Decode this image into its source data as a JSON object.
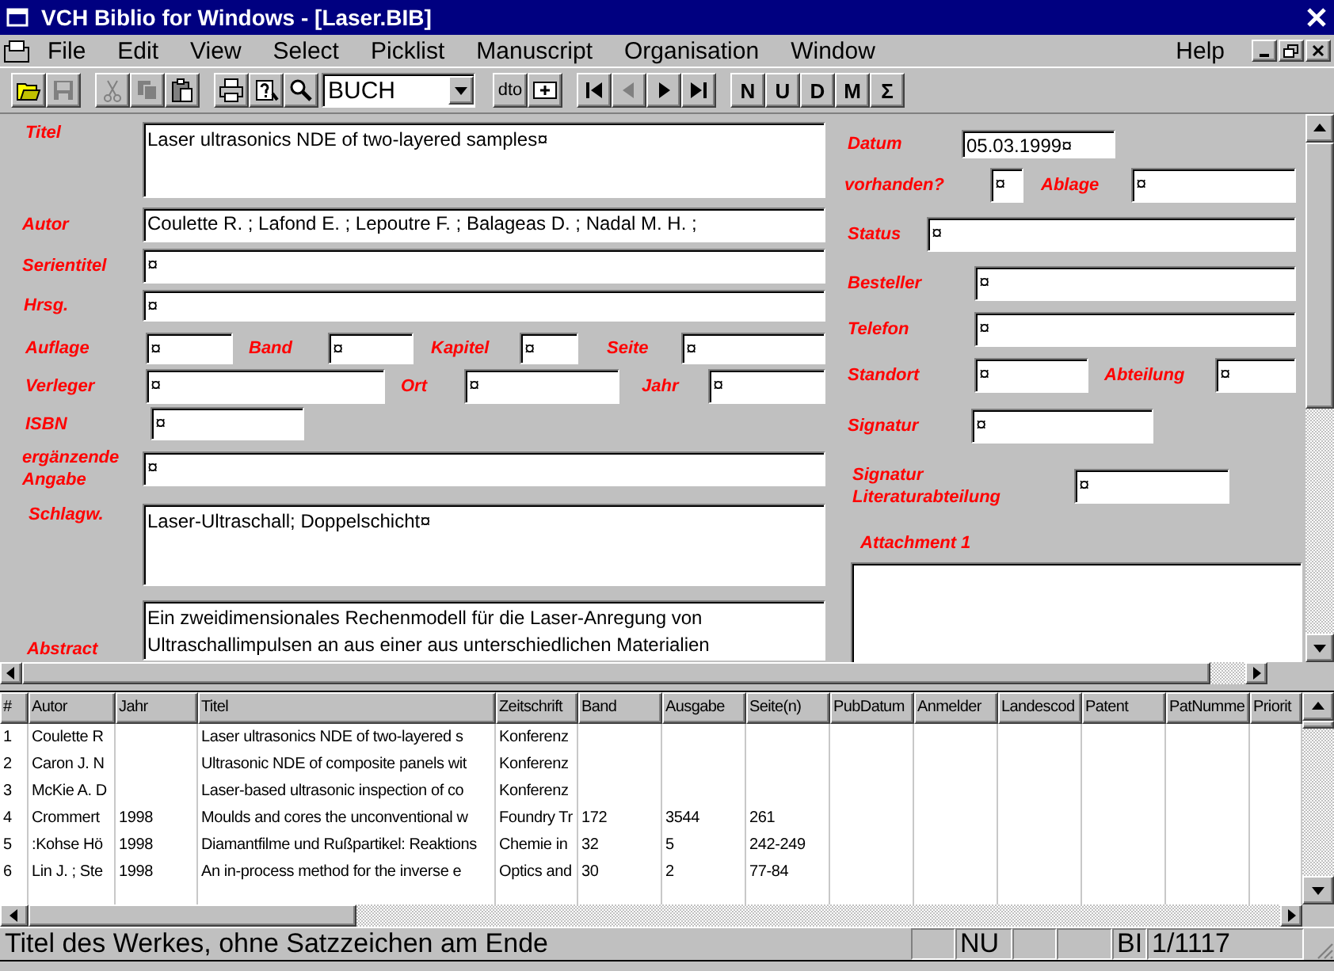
{
  "window": {
    "title": "VCH Biblio for Windows - [Laser.BIB]"
  },
  "menu": {
    "items": [
      "File",
      "Edit",
      "View",
      "Select",
      "Picklist",
      "Manuscript",
      "Organisation",
      "Window"
    ],
    "help": "Help"
  },
  "toolbar": {
    "groups": [
      {
        "items": [
          {
            "kind": "open",
            "disabled": false
          },
          {
            "kind": "save",
            "disabled": true
          }
        ]
      },
      {
        "items": [
          {
            "kind": "cut",
            "disabled": true
          },
          {
            "kind": "copy",
            "disabled": true
          },
          {
            "kind": "paste",
            "disabled": false
          }
        ]
      },
      {
        "items": [
          {
            "kind": "print",
            "disabled": false
          },
          {
            "kind": "help",
            "disabled": false
          },
          {
            "kind": "search",
            "disabled": false
          },
          {
            "kind": "combo",
            "value": "BUCH"
          }
        ]
      },
      {
        "items": [
          {
            "kind": "text",
            "label": "dto",
            "disabled": false
          },
          {
            "kind": "add",
            "disabled": false
          }
        ]
      },
      {
        "items": [
          {
            "kind": "first",
            "disabled": false
          },
          {
            "kind": "prev",
            "disabled": true
          },
          {
            "kind": "next",
            "disabled": false
          },
          {
            "kind": "last",
            "disabled": false
          }
        ]
      },
      {
        "items": [
          {
            "kind": "text",
            "label": "N",
            "disabled": false
          },
          {
            "kind": "text",
            "label": "U",
            "disabled": false
          },
          {
            "kind": "text",
            "label": "D",
            "disabled": false
          },
          {
            "kind": "text",
            "label": "M",
            "disabled": false
          },
          {
            "kind": "text",
            "label": "Σ",
            "disabled": false
          }
        ]
      }
    ]
  },
  "form": {
    "left": [
      [
        {
          "kind": "label",
          "text": "Titel"
        },
        {
          "kind": "memo",
          "value": "Laser ultrasonics NDE of two-layered samples¤"
        }
      ],
      [
        {
          "kind": "label",
          "text": "Autor"
        },
        {
          "kind": "field",
          "value": "Coulette R. ; Lafond E. ; Lepoutre F. ; Balageas D. ; Nadal M. H. ;"
        }
      ],
      [
        {
          "kind": "label",
          "text": "Serientitel"
        },
        {
          "kind": "field",
          "value": "¤"
        }
      ],
      [
        {
          "kind": "label",
          "text": "Hrsg."
        },
        {
          "kind": "field",
          "value": "¤"
        }
      ],
      [
        {
          "kind": "label",
          "text": "Auflage"
        },
        {
          "kind": "field",
          "value": "¤"
        },
        {
          "kind": "label",
          "text": "Band"
        },
        {
          "kind": "field",
          "value": "¤"
        },
        {
          "kind": "label",
          "text": "Kapitel"
        },
        {
          "kind": "field",
          "value": "¤"
        },
        {
          "kind": "label",
          "text": "Seite"
        },
        {
          "kind": "field",
          "value": "¤"
        }
      ],
      [
        {
          "kind": "label",
          "text": "Verleger"
        },
        {
          "kind": "field",
          "value": "¤"
        },
        {
          "kind": "label",
          "text": "Ort"
        },
        {
          "kind": "field",
          "value": "¤"
        },
        {
          "kind": "label",
          "text": "Jahr"
        },
        {
          "kind": "field",
          "value": "¤"
        }
      ],
      [
        {
          "kind": "label",
          "text": "ISBN"
        },
        {
          "kind": "field",
          "value": "¤"
        }
      ],
      [
        {
          "kind": "label",
          "text": "ergänzende Angabe"
        },
        {
          "kind": "field",
          "value": "¤"
        }
      ],
      [
        {
          "kind": "label",
          "text": "Schlagw."
        },
        {
          "kind": "memo",
          "value": "Laser-Ultraschall; Doppelschicht¤"
        }
      ],
      [
        {
          "kind": "label",
          "text": "Abstract"
        },
        {
          "kind": "memo",
          "value": "Ein zweidimensionales Rechenmodell für die Laser-Anregung von Ultraschallimpulsen an aus einer aus unterschiedlichen Materialien"
        }
      ]
    ],
    "right": [
      [
        {
          "kind": "label",
          "text": "Datum"
        },
        {
          "kind": "field",
          "value": "05.03.1999¤"
        }
      ],
      [
        {
          "kind": "label",
          "text": "vorhanden?"
        },
        {
          "kind": "field",
          "value": "¤"
        },
        {
          "kind": "label",
          "text": "Ablage"
        },
        {
          "kind": "field",
          "value": "¤"
        }
      ],
      [
        {
          "kind": "label",
          "text": "Status"
        },
        {
          "kind": "field",
          "value": "¤"
        }
      ],
      [
        {
          "kind": "label",
          "text": "Besteller"
        },
        {
          "kind": "field",
          "value": "¤"
        }
      ],
      [
        {
          "kind": "label",
          "text": "Telefon"
        },
        {
          "kind": "field",
          "value": "¤"
        }
      ],
      [
        {
          "kind": "label",
          "text": "Standort"
        },
        {
          "kind": "field",
          "value": "¤"
        },
        {
          "kind": "label",
          "text": "Abteilung"
        },
        {
          "kind": "field",
          "value": "¤"
        }
      ],
      [
        {
          "kind": "label",
          "text": "Signatur"
        },
        {
          "kind": "field",
          "value": "¤"
        }
      ],
      [
        {
          "kind": "label",
          "text": "Signatur Literaturabteilung"
        },
        {
          "kind": "field",
          "value": "¤"
        }
      ],
      [
        {
          "kind": "label",
          "text": "Attachment 1"
        }
      ],
      [
        {
          "kind": "memo"
        }
      ]
    ]
  },
  "table": {
    "columns": [
      "#",
      "Autor",
      "Jahr",
      "Titel",
      "Zeitschrift",
      "Band",
      "Ausgabe",
      "Seite(n)",
      "PubDatum",
      "Anmelder",
      "Landescod",
      "Patent",
      "PatNumme",
      "Priorit"
    ],
    "rows": [
      {
        "number": "1",
        "autor": "Coulette R",
        "titel": "Laser ultrasonics NDE of two-layered s",
        "zeitschrift": "Konferenz"
      },
      {
        "number": "2",
        "autor": "Caron J. N",
        "titel": "Ultrasonic NDE of composite panels wit",
        "zeitschrift": "Konferenz"
      },
      {
        "number": "3",
        "autor": "McKie A. D",
        "titel": "Laser-based ultrasonic inspection of co",
        "zeitschrift": "Konferenz"
      },
      {
        "number": "4",
        "autor": "Crommert",
        "jahr": "1998",
        "titel": "Moulds and cores the unconventional w",
        "zeitschrift": "Foundry Tr",
        "band": "172",
        "ausgabe": "3544",
        "seiten": "261"
      },
      {
        "number": "5",
        "autor": ":Kohse Hö",
        "jahr": "1998",
        "titel": "Diamantfilme und Rußpartikel: Reaktions",
        "zeitschrift": "Chemie in",
        "band": "32",
        "ausgabe": "5",
        "seiten": "242-249"
      },
      {
        "number": "6",
        "autor": "Lin J. ; Ste",
        "jahr": "1998",
        "titel": "An in-process method for the inverse e",
        "zeitschrift": "Optics and",
        "band": "30",
        "ausgabe": "2",
        "seiten": "77-84"
      }
    ]
  },
  "status_bar": {
    "message": "Titel des Werkes, ohne Satzzeichen am Ende",
    "panels": [
      {
        "text": "NU"
      },
      {
        "text": "BI"
      },
      {
        "text": "1/1117"
      }
    ]
  }
}
